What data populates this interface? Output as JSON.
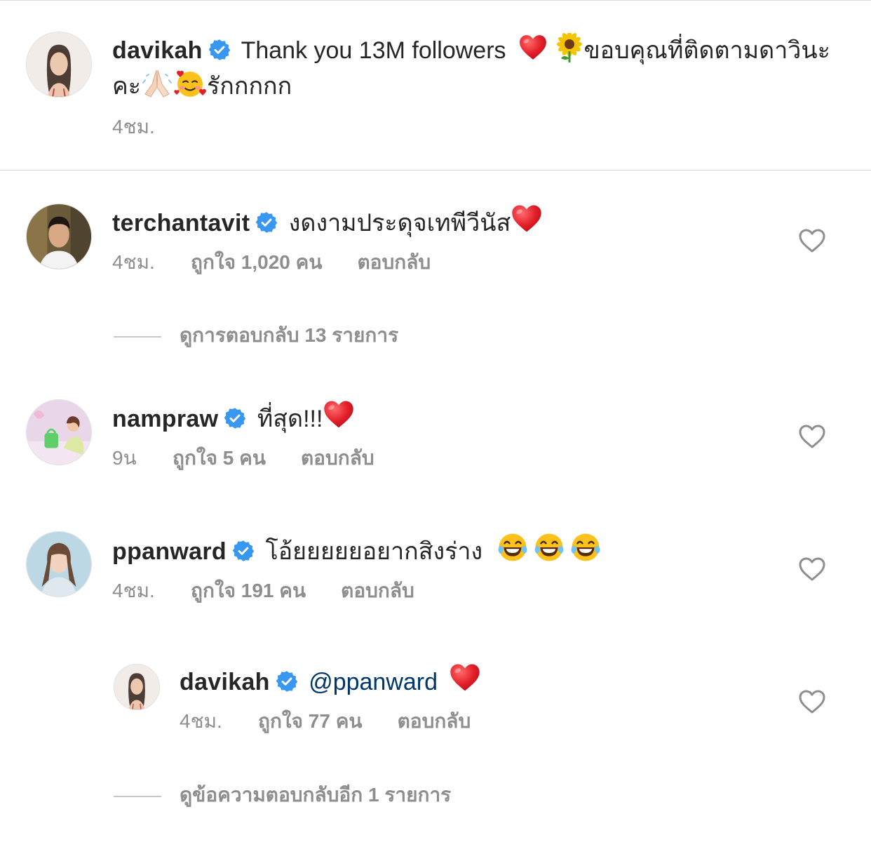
{
  "caption": {
    "username": "davikah",
    "text_part1": "Thank you 13M followers",
    "text_part2": "ขอบคุณที่ติดตามดาวินะคะ",
    "text_part3": "รักกกกก",
    "time": "4ชม."
  },
  "comments": [
    {
      "username": "terchantavit",
      "text": "งดงามประดุจเทพีวีนัส",
      "time": "4ชม.",
      "likes": "ถูกใจ 1,020 คน",
      "reply_label": "ตอบกลับ",
      "view_replies": "ดูการตอบกลับ 13 รายการ"
    },
    {
      "username": "nampraw",
      "text": "ที่สุด!!!",
      "time": "9น",
      "likes": "ถูกใจ 5 คน",
      "reply_label": "ตอบกลับ"
    },
    {
      "username": "ppanward",
      "text": "โอ้ยยยยยอยากสิงร่าง",
      "time": "4ชม.",
      "likes": "ถูกใจ 191 คน",
      "reply_label": "ตอบกลับ"
    }
  ],
  "reply": {
    "username": "davikah",
    "mention": "@ppanward",
    "time": "4ชม.",
    "likes": "ถูกใจ 77 คน",
    "reply_label": "ตอบกลับ",
    "view_more": "ดูข้อความตอบกลับอีก 1 รายการ"
  },
  "icons": {
    "verified": "verified-badge-icon",
    "like": "heart-outline-icon",
    "heart_emoji": "red-heart-emoji",
    "sunflower_emoji": "sunflower-emoji",
    "pray_emoji": "folded-hands-emoji",
    "smile_hearts_emoji": "smiling-face-with-hearts-emoji",
    "laugh_emoji": "face-with-tears-of-joy-emoji"
  },
  "colors": {
    "verified_blue": "#3897f0",
    "meta_gray": "#8e8e8e",
    "mention_blue": "#00376b",
    "heart_red": "#e0202a"
  }
}
